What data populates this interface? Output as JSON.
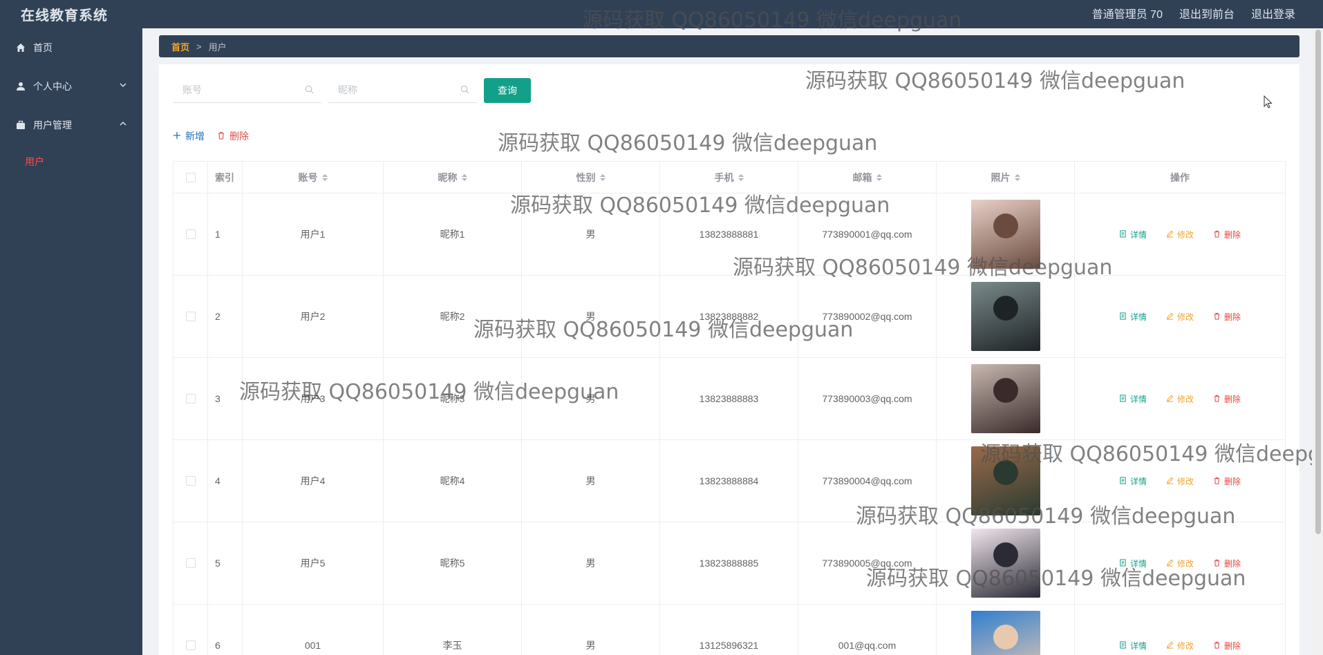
{
  "app": {
    "title": "在线教育系统",
    "user_label": "普通管理员 70",
    "to_front_label": "退出到前台",
    "logout_label": "退出登录"
  },
  "sidebar": {
    "items": [
      {
        "label": "首页",
        "icon": "home-icon"
      },
      {
        "label": "个人中心",
        "icon": "user-icon"
      },
      {
        "label": "用户管理",
        "icon": "briefcase-icon"
      }
    ],
    "sub_items": [
      {
        "label": "用户"
      }
    ]
  },
  "breadcrumb": {
    "home": "首页",
    "separator": ">",
    "current": "用户"
  },
  "search": {
    "account_placeholder": "账号",
    "nickname_placeholder": "昵称",
    "query_label": "查询"
  },
  "actions": {
    "add_label": "新增",
    "delete_label": "删除"
  },
  "table": {
    "headers": {
      "index": "索引",
      "account": "账号",
      "nickname": "昵称",
      "gender": "性别",
      "phone": "手机",
      "email": "邮箱",
      "photo": "照片",
      "ops": "操作"
    },
    "op_labels": {
      "detail": "详情",
      "edit": "修改",
      "delete": "删除"
    },
    "rows": [
      {
        "index": "1",
        "account": "用户1",
        "nickname": "昵称1",
        "gender": "男",
        "phone": "13823888881",
        "email": "773890001@qq.com"
      },
      {
        "index": "2",
        "account": "用户2",
        "nickname": "昵称2",
        "gender": "男",
        "phone": "13823888882",
        "email": "773890002@qq.com"
      },
      {
        "index": "3",
        "account": "用户3",
        "nickname": "昵称3",
        "gender": "男",
        "phone": "13823888883",
        "email": "773890003@qq.com"
      },
      {
        "index": "4",
        "account": "用户4",
        "nickname": "昵称4",
        "gender": "男",
        "phone": "13823888884",
        "email": "773890004@qq.com"
      },
      {
        "index": "5",
        "account": "用户5",
        "nickname": "昵称5",
        "gender": "男",
        "phone": "13823888885",
        "email": "773890005@qq.com"
      },
      {
        "index": "6",
        "account": "001",
        "nickname": "李玉",
        "gender": "男",
        "phone": "13125896321",
        "email": "001@qq.com"
      }
    ]
  },
  "watermark": {
    "text": "源码获取 QQ86050149 微信deepguan"
  },
  "colors": {
    "sidebar_bg": "#304156",
    "accent_green": "#13a08a",
    "active_menu": "#ff4d4f",
    "edit_orange": "#f0a431",
    "delete_red": "#e5463f"
  }
}
